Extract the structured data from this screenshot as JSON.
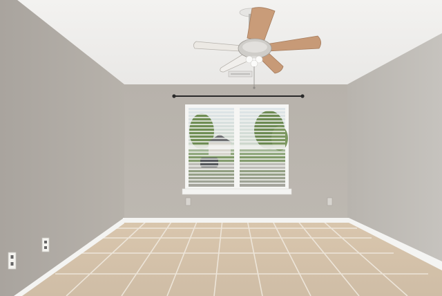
{
  "scene": {
    "subject": "empty room",
    "colors": {
      "ceiling": "#f1f0ee",
      "back_wall": "#b9b4ad",
      "left_wall": "#b0aba5",
      "right_wall": "#c0bcb6",
      "baseboard": "#f4f4f2",
      "floor_tile": "#d6c3aa",
      "grout": "#ece4d8",
      "fan_blade": "#c79a77",
      "window_frame": "#f6f6f4"
    }
  }
}
